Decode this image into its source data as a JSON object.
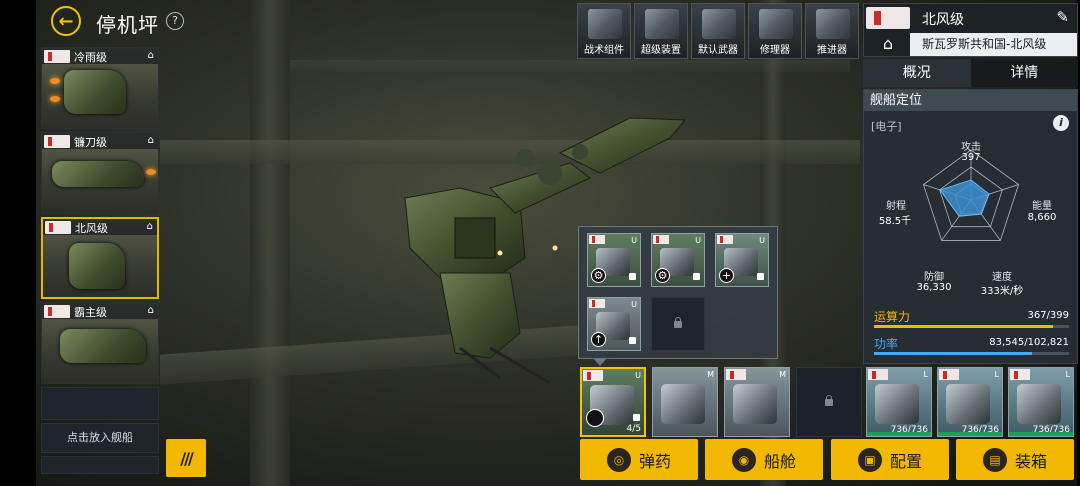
{
  "header": {
    "back_glyph": "←",
    "title": "停机坪",
    "help": "?"
  },
  "ship_list": [
    {
      "name": "冷雨级",
      "class_icon": "⌂",
      "selected": false
    },
    {
      "name": "镰刀级",
      "class_icon": "⌂",
      "selected": false
    },
    {
      "name": "北风级",
      "class_icon": "⌂",
      "selected": true
    },
    {
      "name": "霸主级",
      "class_icon": "⌂",
      "selected": false
    }
  ],
  "place_ship_label": "点击放入舰船",
  "menu_button_glyph": "///",
  "module_tabs": [
    {
      "label": "战术组件",
      "icon": "tactical-component-icon"
    },
    {
      "label": "超级装置",
      "icon": "super-device-icon"
    },
    {
      "label": "默认武器",
      "icon": "default-weapon-icon"
    },
    {
      "label": "修理器",
      "icon": "repairer-icon"
    },
    {
      "label": "推进器",
      "icon": "thruster-icon"
    }
  ],
  "info": {
    "ship_class": "北风级",
    "edit_icon": "✎",
    "home_icon": "⌂",
    "faction": "斯瓦罗斯共和国-北风级",
    "tabs": [
      "概况",
      "详情"
    ],
    "active_tab": 0,
    "role_title": "舰船定位",
    "role_type": "[电子]",
    "info_glyph": "i",
    "stats": {
      "attack": {
        "label": "攻击",
        "value": "397",
        "level": 0.4
      },
      "capacity": {
        "label": "能量",
        "value": "8,660",
        "level": 0.38
      },
      "speed": {
        "label": "速度",
        "value": "333米/秒",
        "level": 0.35
      },
      "defense": {
        "label": "防御",
        "value": "36,330",
        "level": 0.4
      },
      "range": {
        "label": "射程",
        "value": "58.5千",
        "level": 0.65
      }
    },
    "compute": {
      "label": "运算力",
      "value": "367/399",
      "fraction": 0.92,
      "color": "#f2b800"
    },
    "power": {
      "label": "功率",
      "value": "83,545/102,821",
      "fraction": 0.81,
      "color": "#4aa9f0"
    }
  },
  "popup_modules": [
    {
      "side": "U",
      "action": "⚙"
    },
    {
      "side": "U",
      "action": "⚙"
    },
    {
      "side": "U",
      "action": "+"
    },
    {
      "side": "U",
      "action": "↑"
    }
  ],
  "bottom_slots": [
    {
      "side": "U",
      "count": "4/5"
    },
    {
      "side": "M",
      "count": ""
    },
    {
      "side": "M",
      "count": ""
    },
    {
      "side": "L",
      "count": "736/736"
    },
    {
      "side": "L",
      "count": "736/736"
    },
    {
      "side": "L",
      "count": "736/736"
    }
  ],
  "actions": [
    {
      "label": "弹药",
      "icon": "ammo-icon",
      "glyph": "◎"
    },
    {
      "label": "船舱",
      "icon": "cabin-icon",
      "glyph": "◉"
    },
    {
      "label": "配置",
      "icon": "config-icon",
      "glyph": "▣"
    },
    {
      "label": "装箱",
      "icon": "crate-icon",
      "glyph": "▤"
    }
  ]
}
